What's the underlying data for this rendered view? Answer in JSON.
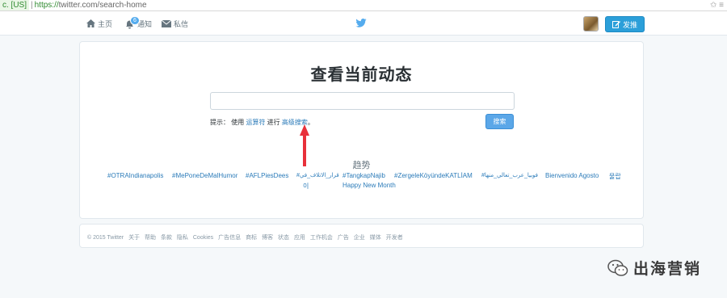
{
  "browser": {
    "cert": "c. [US]",
    "url_scheme": "https://",
    "url_rest": "twitter.com/search-home",
    "icons": "✩ ≡"
  },
  "nav": {
    "home": "主页",
    "notifications": "通知",
    "notifications_badge": "6",
    "messages": "私信",
    "tweet_button": "发推"
  },
  "main": {
    "title": "查看当前动态",
    "search_placeholder": "",
    "hint_prefix": "提示： 使用 ",
    "hint_operators": "运算符",
    "hint_middle": " 进行 ",
    "hint_advanced": "高级搜索",
    "hint_suffix": "。",
    "search_button": "搜索"
  },
  "trends": {
    "title": "趋势",
    "items": [
      "#OTRAIndianapolis",
      "#MePoneDeMalHumor",
      "#AFLPiesDees",
      "#قرار_الاتلاف_في",
      "#TangkapNajib",
      "#ZergeleKöyündeKATLİAM",
      "#فوبيا_عرب_تعالي_منها",
      "Bienvenido Agosto",
      "물랍",
      "이",
      "Happy New Month"
    ]
  },
  "footer": {
    "links": [
      "© 2015 Twitter",
      "关于",
      "帮助",
      "条款",
      "隐私",
      "Cookies",
      "广告信息",
      "商标",
      "博客",
      "状态",
      "应用",
      "工作机会",
      "广告",
      "企业",
      "媒体",
      "开发者"
    ]
  },
  "watermark": {
    "text": "出海营销"
  },
  "colors": {
    "twitter_blue": "#55acee",
    "link": "#2b7bb9",
    "arrow": "#e8303a"
  }
}
